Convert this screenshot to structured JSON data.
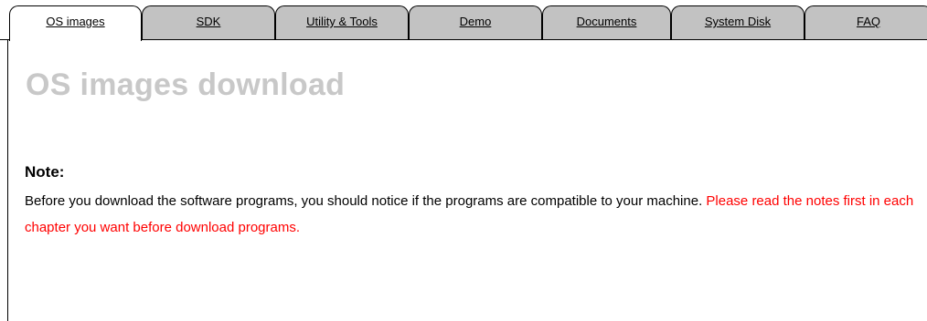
{
  "tabs": [
    {
      "label": "OS images",
      "active": true
    },
    {
      "label": "SDK",
      "active": false
    },
    {
      "label": "Utility & Tools",
      "active": false
    },
    {
      "label": "Demo",
      "active": false
    },
    {
      "label": "Documents",
      "active": false
    },
    {
      "label": "System Disk",
      "active": false
    },
    {
      "label": "FAQ",
      "active": false
    }
  ],
  "page": {
    "title": "OS images download",
    "note_heading": "Note:",
    "note_text": "Before you download the software programs, you should notice if the programs are compatible to your machine.",
    "note_warning": "Please read the notes first in each chapter you want before download programs."
  },
  "colors": {
    "title_gray": "#c8c8c8",
    "tab_inactive": "#c2c2c2",
    "warning_red": "#ff0000"
  }
}
